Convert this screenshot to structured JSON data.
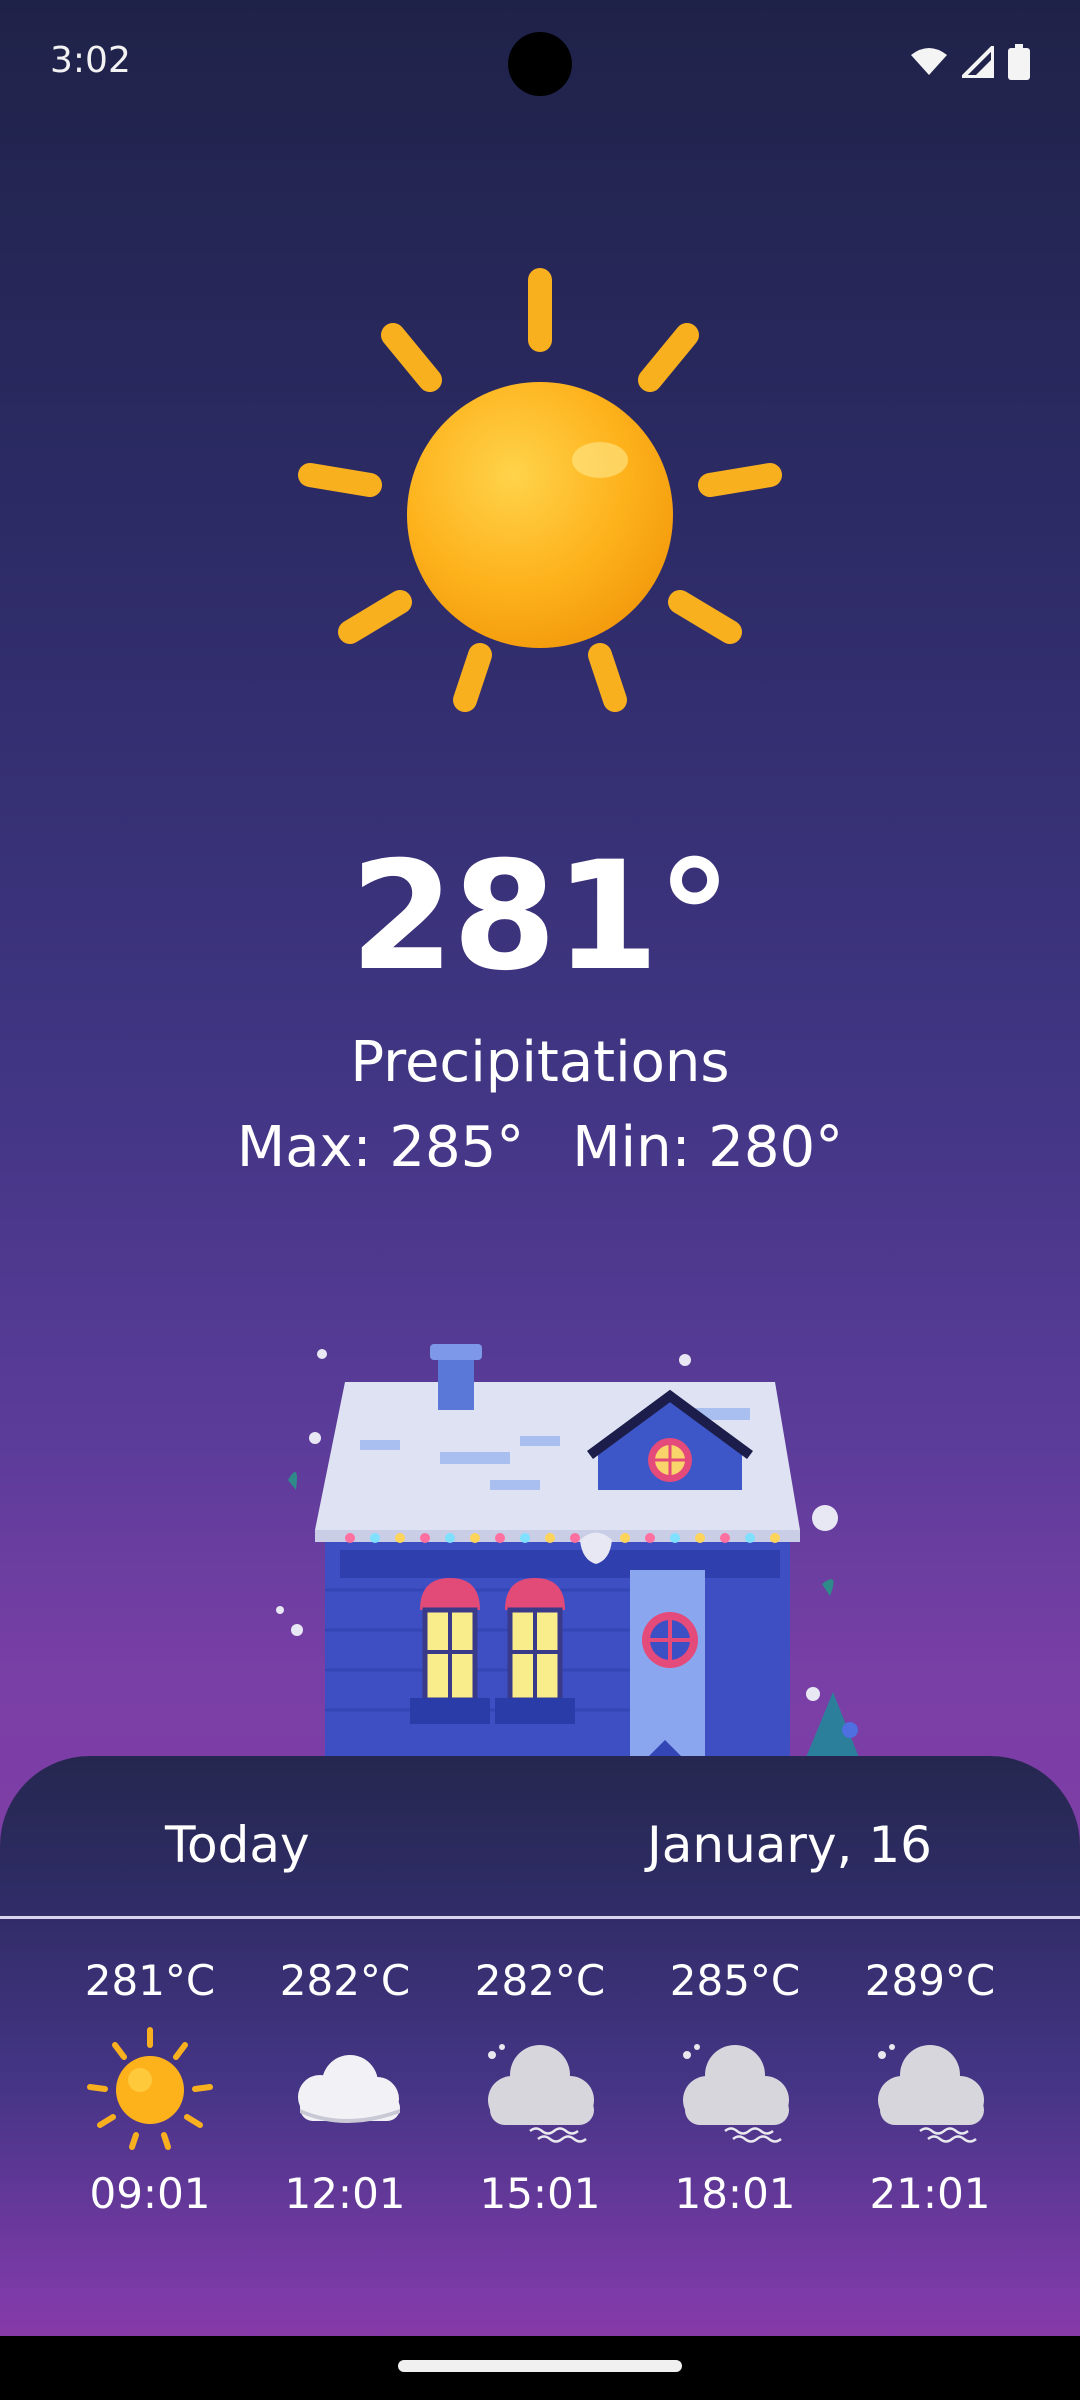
{
  "status_bar": {
    "time": "3:02",
    "icons": [
      "wifi-icon",
      "signal-icon",
      "battery-icon"
    ]
  },
  "current": {
    "condition_icon": "sun-icon",
    "temperature": "281°",
    "description": "Precipitations",
    "max": "Max: 285°",
    "min": "Min: 280°"
  },
  "illustration": "snowy-house-illustration",
  "forecast": {
    "day_label": "Today",
    "date_label": "January, 16",
    "hours": [
      {
        "temp": "281°C",
        "icon": "sun-icon",
        "time": "09:01"
      },
      {
        "temp": "282°C",
        "icon": "cloud-icon",
        "time": "12:01"
      },
      {
        "temp": "282°C",
        "icon": "fog-cloud-icon",
        "time": "15:01"
      },
      {
        "temp": "285°C",
        "icon": "fog-cloud-icon",
        "time": "18:01"
      },
      {
        "temp": "289°C",
        "icon": "fog-cloud-icon",
        "time": "21:01"
      }
    ]
  },
  "colors": {
    "sun": "#FBB224",
    "ray": "#F9B01F",
    "background_top": "#1F2248",
    "background_bottom": "#8A3AA6"
  }
}
